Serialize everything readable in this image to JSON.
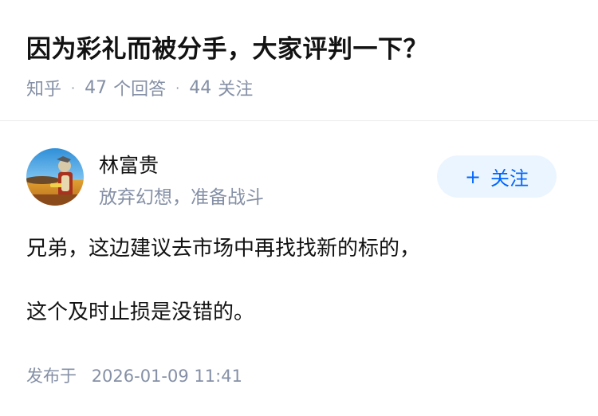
{
  "question": {
    "title": "因为彩礼而被分手，大家评判一下？",
    "source": "知乎",
    "separator": "·",
    "answer_count": "47",
    "answer_unit": "个回答",
    "follow_count": "44",
    "follow_unit": "关注"
  },
  "author": {
    "name": "林富贵",
    "bio": "放弃幻想，准备战斗",
    "avatar_icon": "avatar-illustration-icon"
  },
  "follow_button": {
    "plus": "+",
    "label": "关注",
    "color": "#0066ff",
    "background": "#ebf5ff"
  },
  "answer": {
    "paragraphs": [
      "兄弟，这边建议去市场中再找找新的标的，",
      "这个及时止损是没错的。"
    ],
    "published_label": "发布于",
    "published_time": "2026-01-09 11:41"
  },
  "colors": {
    "text": "#121212",
    "muted": "#8590a6",
    "divider": "#ebebeb"
  }
}
